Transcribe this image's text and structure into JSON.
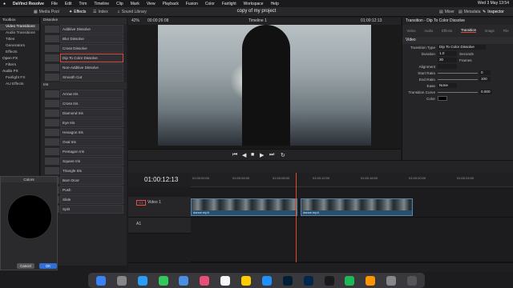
{
  "menubar": {
    "apple": "",
    "app_name": "DaVinci Resolve",
    "items": [
      "File",
      "Edit",
      "Trim",
      "Timeline",
      "Clip",
      "Mark",
      "View",
      "Playback",
      "Fusion",
      "Color",
      "Fairlight",
      "Workspace",
      "Help"
    ],
    "clock": "Wed 3 May 13:54"
  },
  "toolbar": {
    "media_pool": "Media Pool",
    "effects": "Effects",
    "index": "Index",
    "sound_library": "Sound Library",
    "project_title": "copy of my project",
    "mixer": "Mixer",
    "metadata": "Metadata",
    "inspector": "Inspector"
  },
  "viewer": {
    "zoom": "42%",
    "timecode_left": "00:00:26:08",
    "timeline_name": "Timeline 1",
    "timecode_right": "01:00:12:13"
  },
  "left_tree": {
    "toolbox": "Toolbox",
    "items": [
      "Video Transitions",
      "Audio Transitions",
      "Titles",
      "Generators",
      "Effects"
    ],
    "open_fx": "Open FX",
    "filters": "Filters",
    "audio_fx": "Audio FX",
    "fairlight_fx": "Fairlight FX",
    "au_effects": "AU Effects"
  },
  "effects": {
    "dissolve_header": "Dissolve",
    "dissolve_items": [
      "Additive Dissolve",
      "Blur Dissolve",
      "Cross Dissolve",
      "Dip To Color Dissolve",
      "Non-Additive Dissolve",
      "Smooth Cut"
    ],
    "iris_header": "Iris",
    "iris_items": [
      "Arrow Iris",
      "Cross Iris",
      "Diamond Iris",
      "Eye Iris",
      "Hexagon Iris",
      "Oval Iris",
      "Pentagon Iris",
      "Square Iris",
      "Triangle Iris"
    ],
    "other_items": [
      "Barn Door",
      "Push",
      "Slide",
      "Split"
    ]
  },
  "inspector": {
    "title": "Transition - Dip To Color Dissolve",
    "tabs": [
      "Video",
      "Audio",
      "Effects",
      "Transition",
      "Image",
      "File"
    ],
    "section": "Video",
    "transition_type_label": "Transition Type",
    "transition_type": "Dip To Color Dissolve",
    "duration_label": "Duration",
    "duration_seconds": "1.0",
    "seconds_unit": "Seconds",
    "duration_frames": "30",
    "frames_unit": "Frames",
    "alignment_label": "Alignment",
    "start_ratio_label": "Start Ratio",
    "start_ratio": "0",
    "end_ratio_label": "End Ratio",
    "end_ratio": "100",
    "ease_label": "Ease",
    "ease": "None",
    "curve_label": "Transition Curve",
    "curve": "0.000",
    "color_label": "Color"
  },
  "timeline": {
    "timecode": "01:00:12:13",
    "ruler": [
      "01:00:00:00",
      "01:00:04:00",
      "01:00:08:00",
      "01:00:12:00",
      "01:00:16:00",
      "01:00:20:00",
      "01:00:24:00"
    ],
    "v1": "V1",
    "video_track": "Video 1",
    "a1": "A1",
    "clip1": "dance.mp4",
    "clip2": "dance.mp4"
  },
  "colors_dialog": {
    "title": "Colors",
    "cancel": "Cancel",
    "ok": "OK"
  }
}
